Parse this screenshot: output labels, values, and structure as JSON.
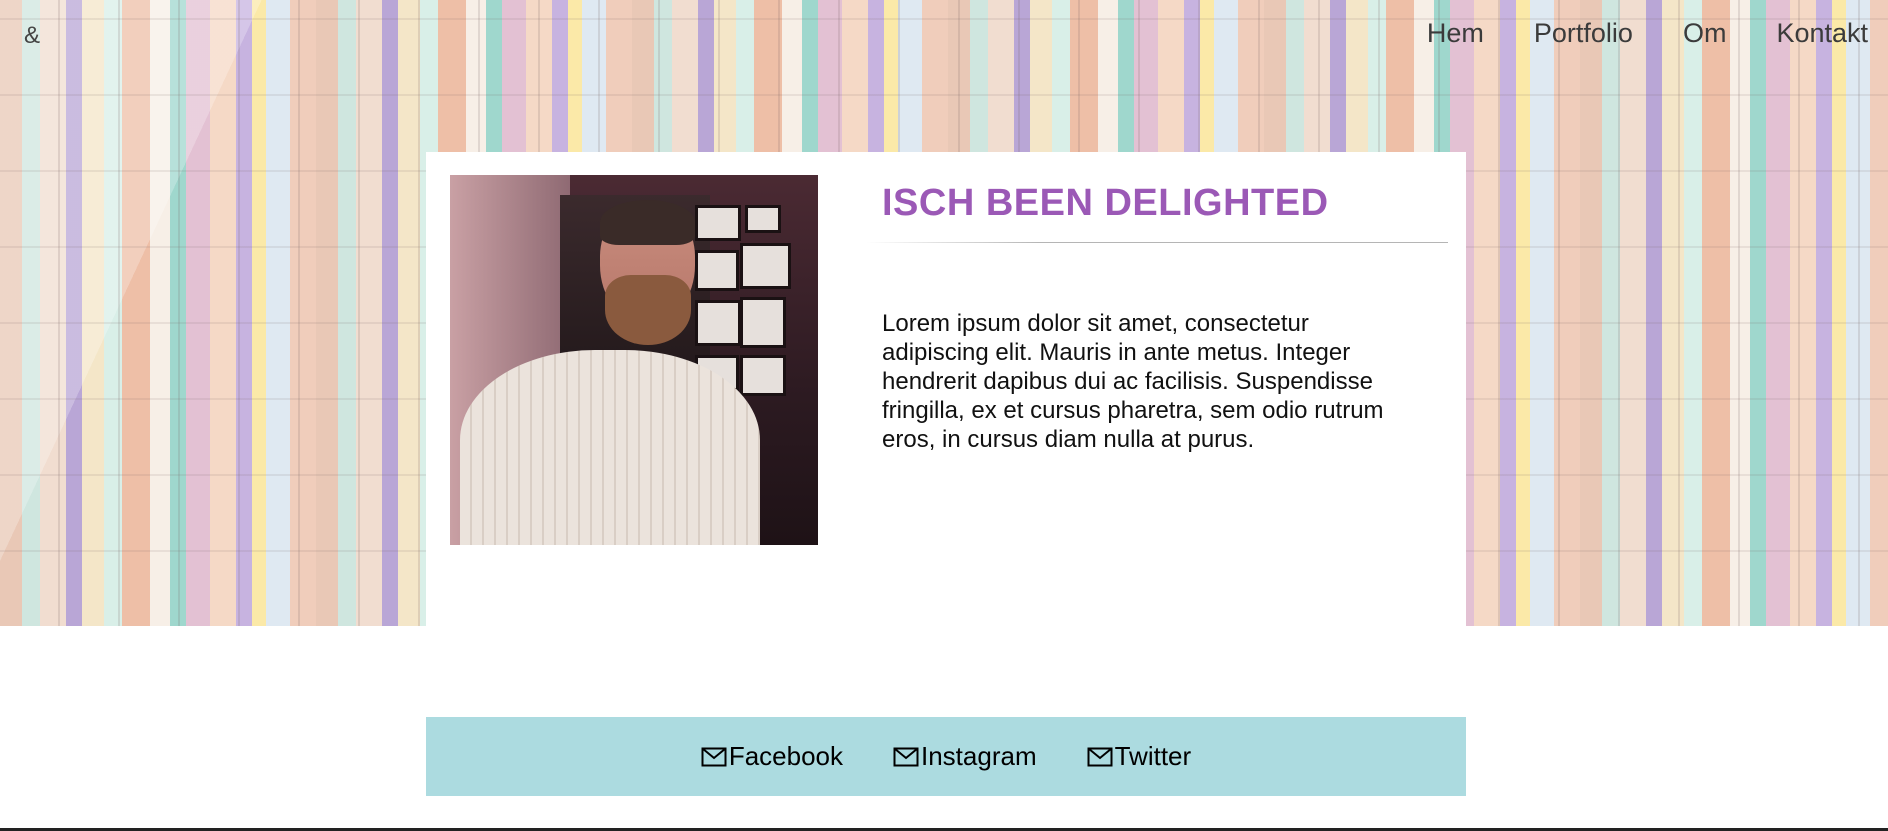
{
  "brand": {
    "logo_text": "&"
  },
  "nav": {
    "items": [
      {
        "label": "Hem"
      },
      {
        "label": "Portfolio"
      },
      {
        "label": "Om"
      },
      {
        "label": "Kontakt"
      }
    ]
  },
  "card": {
    "title": "ISCH BEEN DELIGHTED",
    "body": "Lorem ipsum dolor sit amet, consectetur adipiscing elit. Mauris in ante metus. Integer hendrerit dapibus dui ac facilisis. Suspendisse fringilla, ex et cursus pharetra, sem odio rutrum eros, in cursus diam nulla at purus."
  },
  "footer": {
    "links": [
      {
        "label": "Facebook",
        "icon": "mail-icon"
      },
      {
        "label": "Instagram",
        "icon": "mail-icon"
      },
      {
        "label": "Twitter",
        "icon": "mail-icon"
      }
    ]
  },
  "colors": {
    "title": "#9b59b6",
    "footer_bg": "#acdbe0",
    "card_bg": "#ffffff"
  }
}
